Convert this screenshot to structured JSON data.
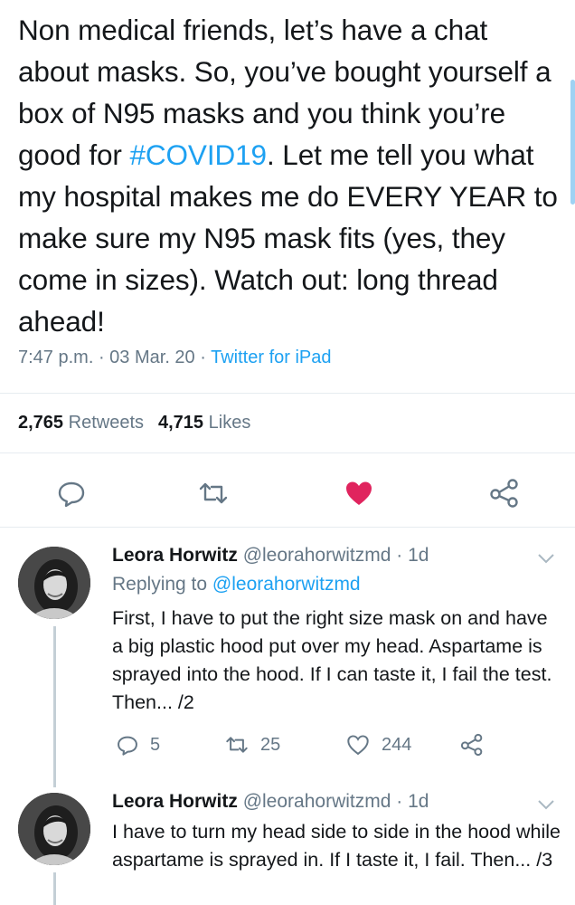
{
  "tweet": {
    "text_part1": "Non medical friends, let’s have a chat about masks. So, you’ve bought yourself a box of N95 masks and you think you’re good for ",
    "hashtag": "#COVID19",
    "text_part2": ". Let me tell you what my hospital makes me do EVERY YEAR to make sure my N95 mask fits (yes, they come in sizes). Watch out: long thread ahead!",
    "time": "7:47 p.m.",
    "date": "03 Mar. 20",
    "separator": " · ",
    "source": "Twitter for iPad",
    "retweets_count": "2,765",
    "retweets_label": "Retweets",
    "likes_count": "4,715",
    "likes_label": "Likes",
    "liked": true
  },
  "colors": {
    "accent": "#1da1f2",
    "like": "#e0245e",
    "text": "#14171a",
    "secondary": "#657786"
  },
  "actions": [
    "reply-icon",
    "retweet-icon",
    "heart-filled-icon",
    "share-icon"
  ],
  "replies": [
    {
      "name": "Leora Horwitz",
      "handle": "@leorahorwitzmd",
      "separator": " · ",
      "age": "1d",
      "replying_prefix": "Replying to ",
      "replying_handle": "@leorahorwitzmd",
      "text": "First, I have to put the right size mask on and have a big plastic hood put over my head. Aspartame is sprayed into the hood. If I can taste it, I fail the test. Then... /2",
      "reply_count": "5",
      "retweet_count": "25",
      "like_count": "244"
    },
    {
      "name": "Leora Horwitz",
      "handle": "@leorahorwitzmd",
      "separator": " · ",
      "age": "1d",
      "text": "I have to turn my head side to side in the hood while aspartame is sprayed in. If I taste it, I fail. Then... /3"
    }
  ]
}
